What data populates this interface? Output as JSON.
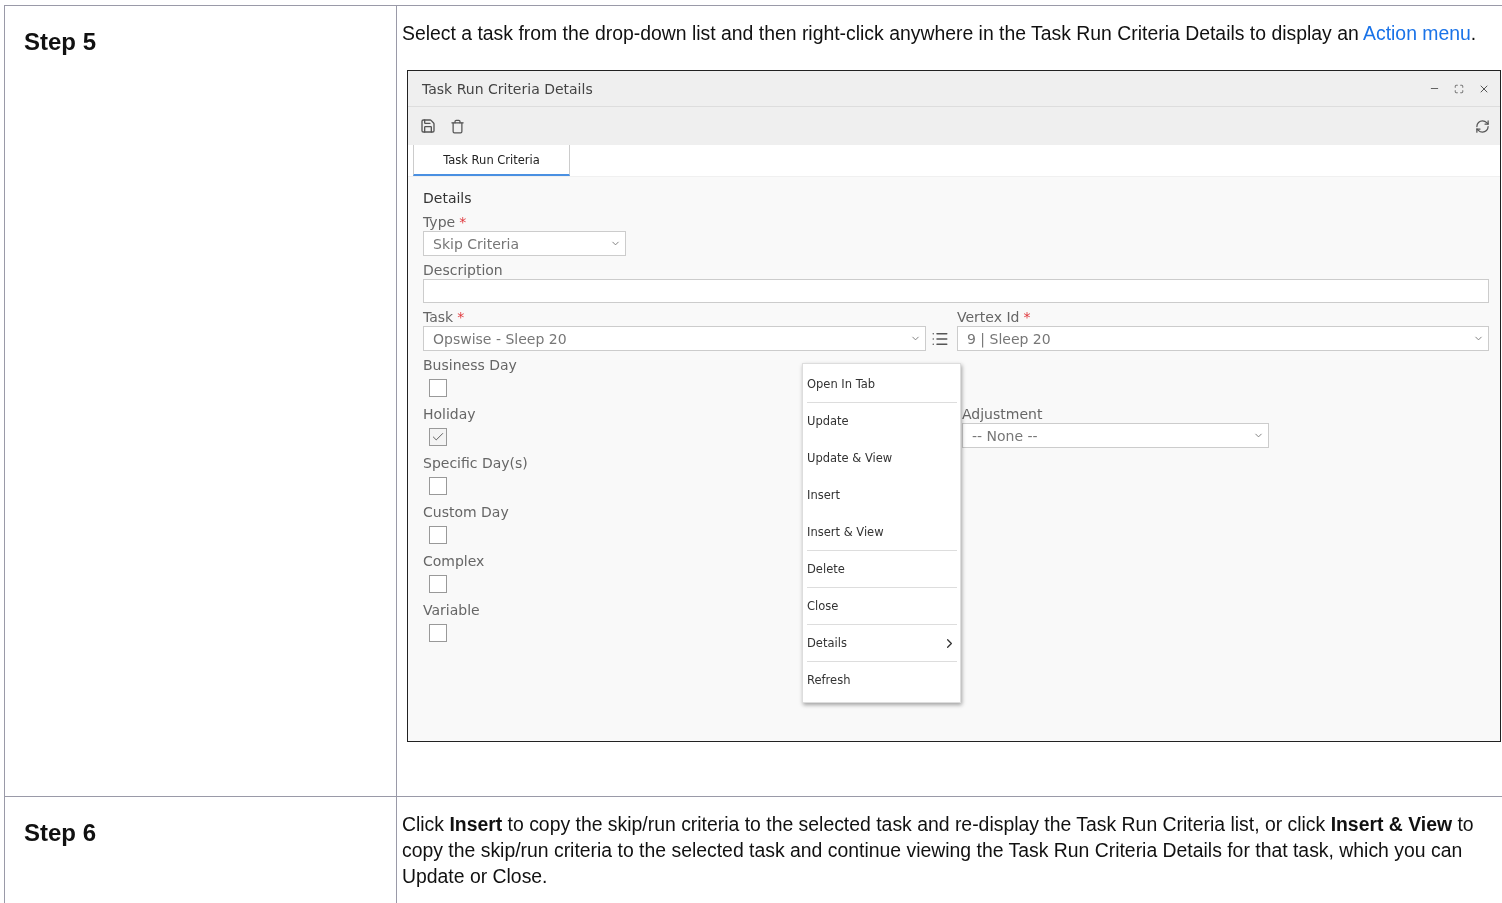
{
  "steps": [
    {
      "label": "Step 5",
      "text": "Select a task from the drop-down list and then right-click anywhere in the Task Run Criteria Details to display an",
      "link": "Action menu",
      "after_link": ".",
      "screenshot": {
        "window": {
          "title": "Task Run Criteria Details"
        },
        "tabs": [
          {
            "label": "Task Run Criteria",
            "selected": true
          }
        ],
        "section_title": "Details",
        "type_field": {
          "label": "Type",
          "required_mark": "*",
          "value": "Skip Criteria"
        },
        "description_field": {
          "label": "Description"
        },
        "task_field": {
          "label": "Task",
          "required_mark": "*",
          "value": "Opswise - Sleep 20"
        },
        "vertex_field": {
          "label": "Vertex Id",
          "required_mark": "*",
          "value": "9 | Sleep 20"
        },
        "checkboxes": [
          {
            "label": "Business Day",
            "checked": false
          },
          {
            "label": "Holiday",
            "checked": true
          },
          {
            "label": "Specific Day(s)",
            "checked": false
          },
          {
            "label": "Custom Day",
            "checked": false
          },
          {
            "label": "Complex",
            "checked": false
          },
          {
            "label": "Variable",
            "checked": false
          }
        ],
        "adjustment_field": {
          "label": "Adjustment",
          "value": "-- None --"
        },
        "context_menu": [
          {
            "label": "Open In Tab",
            "divider_after": true,
            "submenu": false
          },
          {
            "label": "Update",
            "divider_after": false,
            "submenu": false
          },
          {
            "label": "Update & View",
            "divider_after": false,
            "submenu": false
          },
          {
            "label": "Insert",
            "divider_after": false,
            "submenu": false
          },
          {
            "label": "Insert & View",
            "divider_after": true,
            "submenu": false
          },
          {
            "label": "Delete",
            "divider_after": true,
            "submenu": false
          },
          {
            "label": "Close",
            "divider_after": true,
            "submenu": false
          },
          {
            "label": "Details",
            "divider_after": true,
            "submenu": true
          },
          {
            "label": "Refresh",
            "divider_after": false,
            "submenu": false
          }
        ]
      }
    },
    {
      "label": "Step 6",
      "text": "Click **Insert** to copy the skip/run criteria to the selected task and re-display the Task Run Criteria list, or click **Insert & View** to copy the skip/run criteria to the selected task and continue viewing the Task Run Criteria Details for that task, which you can Update or Close."
    }
  ]
}
